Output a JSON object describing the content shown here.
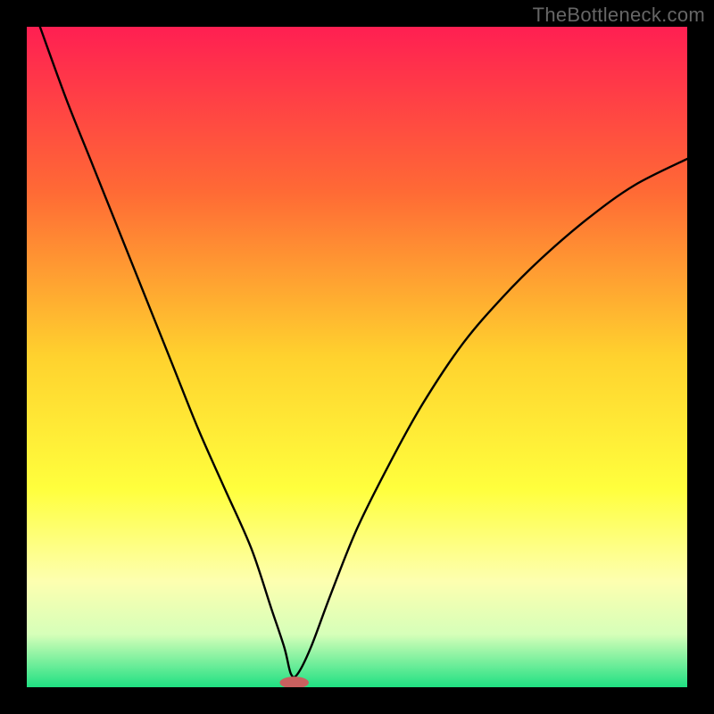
{
  "watermark": "TheBottleneck.com",
  "chart_data": {
    "type": "line",
    "title": "",
    "xlabel": "",
    "ylabel": "",
    "xlim": [
      0,
      100
    ],
    "ylim": [
      0,
      100
    ],
    "gradient_stops": [
      {
        "offset": 0,
        "color": "#ff1f52"
      },
      {
        "offset": 25,
        "color": "#ff6a35"
      },
      {
        "offset": 50,
        "color": "#ffd22e"
      },
      {
        "offset": 70,
        "color": "#ffff3d"
      },
      {
        "offset": 84,
        "color": "#fdffb0"
      },
      {
        "offset": 92,
        "color": "#d6ffb9"
      },
      {
        "offset": 100,
        "color": "#1fe082"
      }
    ],
    "series": [
      {
        "name": "bottleneck-curve",
        "x": [
          2,
          6,
          10,
          14,
          18,
          22,
          26,
          30,
          34,
          37,
          39,
          40,
          41,
          43,
          46,
          50,
          55,
          60,
          66,
          72,
          78,
          85,
          92,
          100
        ],
        "y": [
          100,
          89,
          79,
          69,
          59,
          49,
          39,
          30,
          21,
          12,
          6,
          2,
          2,
          6,
          14,
          24,
          34,
          43,
          52,
          59,
          65,
          71,
          76,
          80
        ]
      }
    ],
    "marker": {
      "x": 40.5,
      "y": 0.7,
      "rx": 2.2,
      "ry": 0.9
    },
    "notes": "y = 0 is bottom (green), y = 100 is top (red). Curve values are estimated from pixels."
  }
}
